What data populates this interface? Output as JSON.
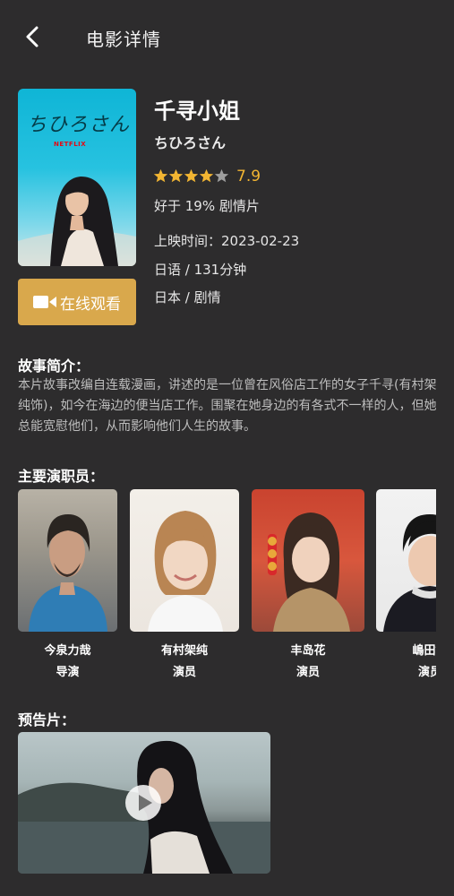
{
  "header": {
    "title": "电影详情"
  },
  "movie": {
    "title_cn": "千寻小姐",
    "title_jp": "ちひろさん",
    "rating": "7.9",
    "stars": 4,
    "praise": "好于 19% 剧情片",
    "release": "上映时间：2023-02-23",
    "language": "日语 / 131分钟",
    "country": "日本 / 剧情",
    "poster": {
      "title": "ちひろさん",
      "brand": "NETFLIX"
    }
  },
  "watch": {
    "label": "在线观看"
  },
  "synopsis": {
    "heading": "故事简介：",
    "text": "本片故事改编自连载漫画，讲述的是一位曾在风俗店工作的女子千寻(有村架纯饰)，如今在海边的便当店工作。围聚在她身边的有各式不一样的人，但她总能宽慰他们，从而影响他们人生的故事。"
  },
  "cast": {
    "heading": "主要演职员：",
    "members": [
      {
        "name": "今泉力哉",
        "role": "导演"
      },
      {
        "name": "有村架纯",
        "role": "演员"
      },
      {
        "name": "丰岛花",
        "role": "演员"
      },
      {
        "name": "嶋田铁",
        "role": "演员"
      }
    ]
  },
  "trailer": {
    "heading": "预告片："
  },
  "colors": {
    "background": "#2d2c2d",
    "accent": "#d9a84c",
    "star": "#f2b532",
    "star_empty": "#9e9e9e"
  }
}
